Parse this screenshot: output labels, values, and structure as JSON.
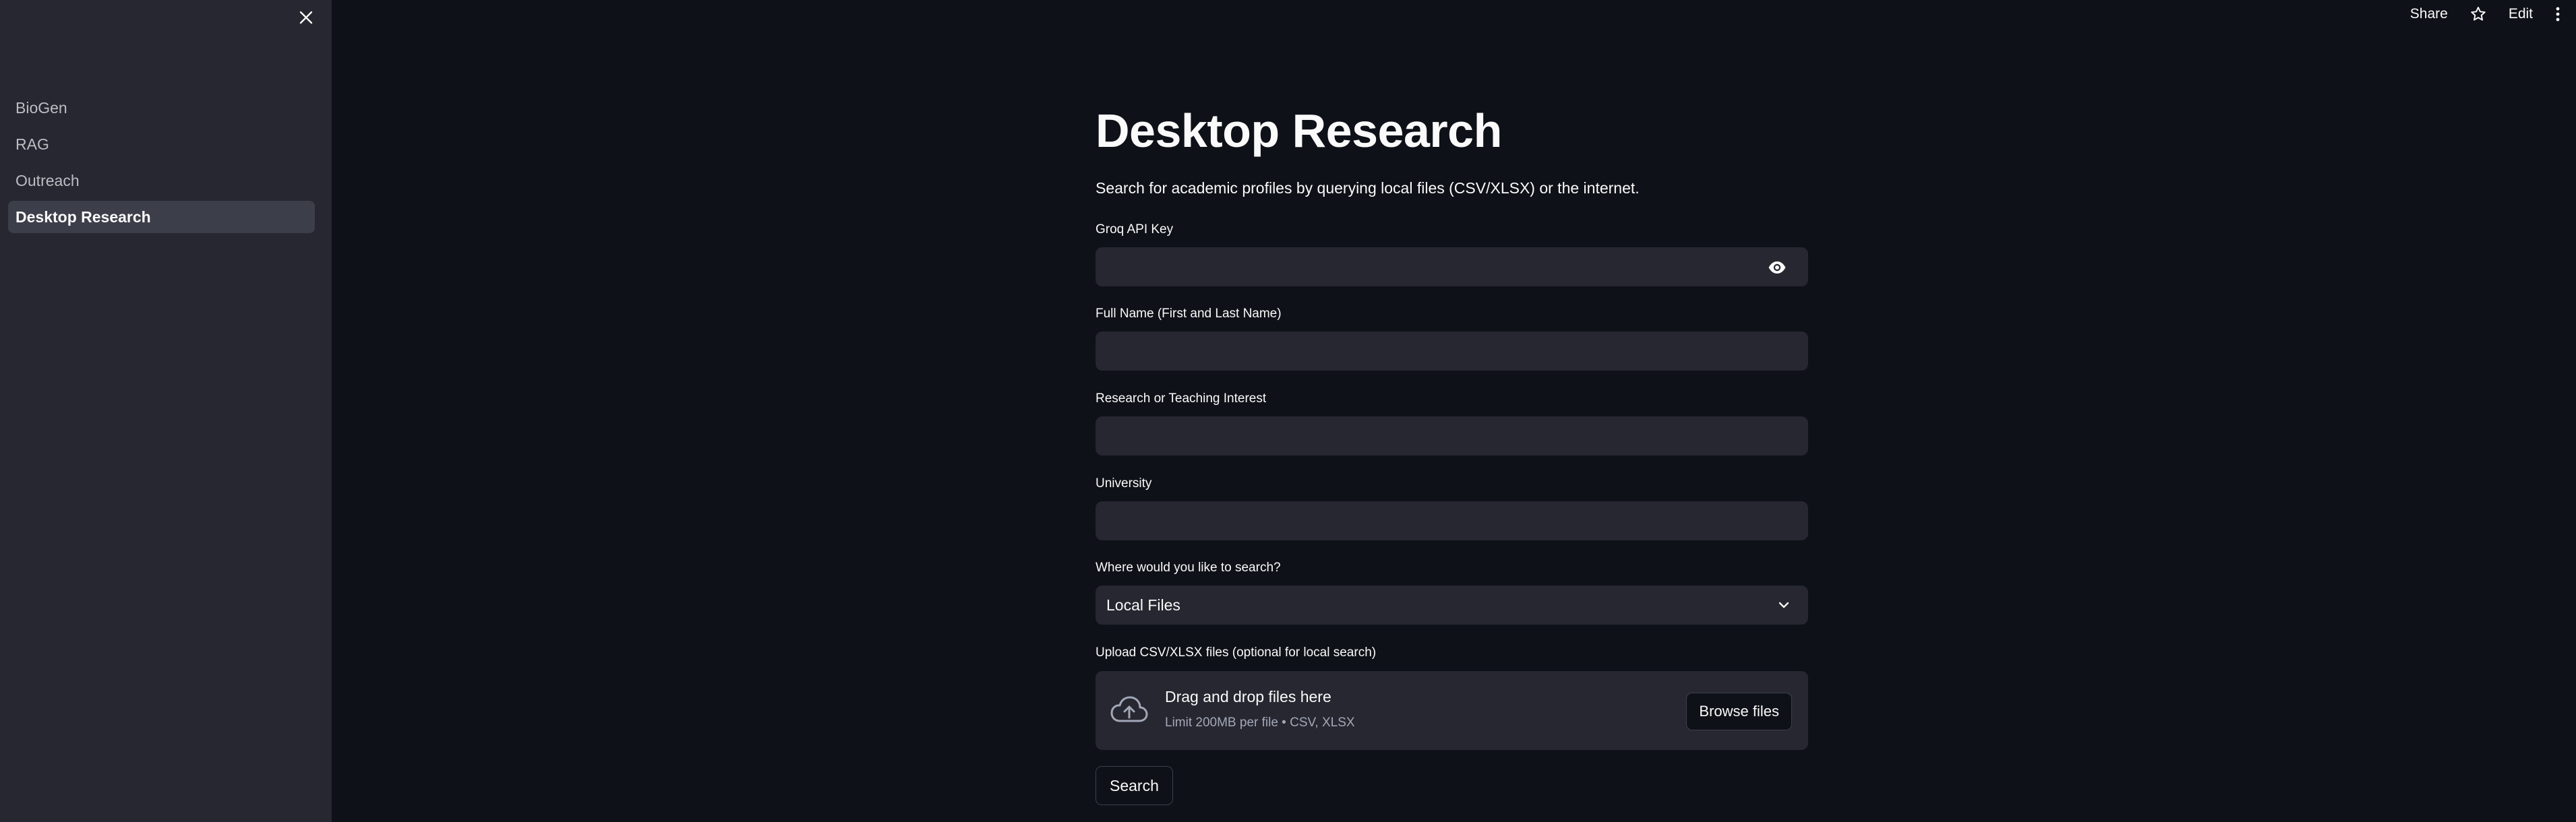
{
  "sidebar": {
    "close_icon": "close-icon",
    "items": [
      {
        "label": "BioGen",
        "active": false
      },
      {
        "label": "RAG",
        "active": false
      },
      {
        "label": "Outreach",
        "active": false
      },
      {
        "label": "Desktop Research",
        "active": true
      }
    ]
  },
  "toolbar": {
    "share_label": "Share",
    "star_icon": "star-icon",
    "edit_label": "Edit",
    "menu_icon": "kebab-menu-icon"
  },
  "main": {
    "title": "Desktop Research",
    "caption": "Search for academic profiles by querying local files (CSV/XLSX) or the internet.",
    "fields": {
      "api_key": {
        "label": "Groq API Key",
        "value": "",
        "icon": "eye-icon"
      },
      "full_name": {
        "label": "Full Name (First and Last Name)",
        "value": ""
      },
      "interest": {
        "label": "Research or Teaching Interest",
        "value": ""
      },
      "university": {
        "label": "University",
        "value": ""
      }
    },
    "search_where": {
      "label": "Where would you like to search?",
      "selected": "Local Files",
      "icon": "chevron-down-icon"
    },
    "upload": {
      "label": "Upload CSV/XLSX files (optional for local search)",
      "drop_title": "Drag and drop files here",
      "drop_sub": "Limit 200MB per file • CSV, XLSX",
      "browse_label": "Browse files",
      "icon": "cloud-upload-icon"
    },
    "search_button": "Search"
  },
  "colors": {
    "background": "#0e1117",
    "sidebar": "#262730",
    "input": "#262730",
    "text": "#fafafa",
    "muted": "#a3a8b8"
  }
}
